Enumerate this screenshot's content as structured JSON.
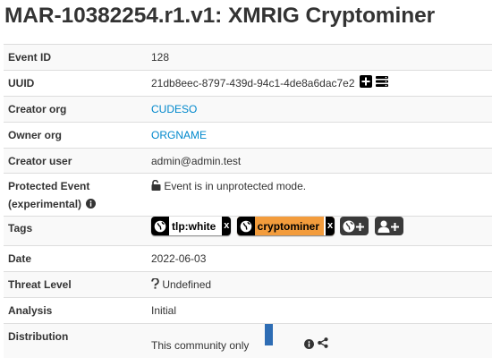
{
  "page_title": "MAR-10382254.r1.v1: XMRIG Cryptominer",
  "rows": {
    "event_id": {
      "label": "Event ID",
      "value": "128"
    },
    "uuid": {
      "label": "UUID",
      "value": "21db8eec-8797-439d-94c1-4de8a6dac7e2"
    },
    "creator_org": {
      "label": "Creator org",
      "value": "CUDESO"
    },
    "owner_org": {
      "label": "Owner org",
      "value": "ORGNAME"
    },
    "creator_user": {
      "label": "Creator user",
      "value": "admin@admin.test"
    },
    "protected": {
      "label_line1": "Protected Event",
      "label_line2": "(experimental)",
      "value": "Event is in unprotected mode."
    },
    "tags": {
      "label": "Tags",
      "items": [
        {
          "text": "tlp:white",
          "color": "#ffffff",
          "remove": "x"
        },
        {
          "text": "cryptominer",
          "color": "#f39c3c",
          "remove": "x"
        }
      ]
    },
    "date": {
      "label": "Date",
      "value": "2022-06-03"
    },
    "threat_level": {
      "label": "Threat Level",
      "value": "Undefined"
    },
    "analysis": {
      "label": "Analysis",
      "value": "Initial"
    },
    "distribution": {
      "label": "Distribution",
      "value": "This community only",
      "bar_color": "#2e6db4"
    }
  },
  "colors": {
    "link": "#0088cc",
    "stripe": "#f9f9f9",
    "border": "#dddddd"
  },
  "icons": [
    "plus-square-icon",
    "server-icon",
    "unlock-icon",
    "info-circle-icon",
    "globe-icon",
    "add-globe-tag-icon",
    "add-user-tag-icon",
    "question-icon",
    "share-icon"
  ]
}
